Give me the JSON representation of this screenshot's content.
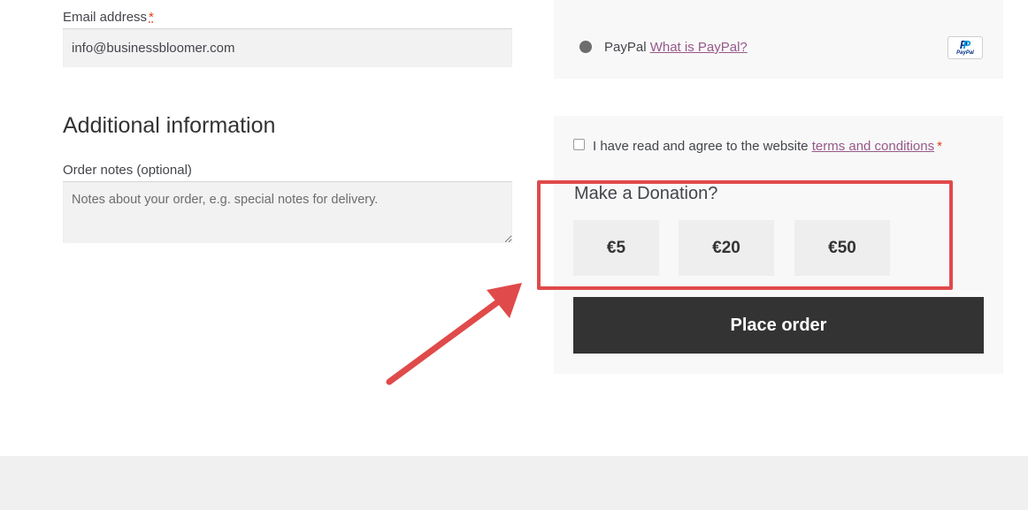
{
  "billing": {
    "email_label": "Email address",
    "email_required_mark": "*",
    "email_value": "info@businessbloomer.com"
  },
  "additional": {
    "title": "Additional information",
    "notes_label": "Order notes (optional)",
    "notes_placeholder": "Notes about your order, e.g. special notes for delivery."
  },
  "payment": {
    "method_label": "PayPal",
    "what_is_link": "What is PayPal?",
    "badge_word": "PayPal"
  },
  "terms": {
    "text": "I have read and agree to the website",
    "link": "terms and conditions",
    "required_mark": "*",
    "checked": false
  },
  "donation": {
    "title": "Make a Donation?",
    "options": [
      "€5",
      "€20",
      "€50"
    ]
  },
  "place_order_label": "Place order",
  "colors": {
    "link": "#96588a",
    "required": "#e2401c",
    "button_dark": "#333333",
    "highlight": "#e04a4a"
  }
}
